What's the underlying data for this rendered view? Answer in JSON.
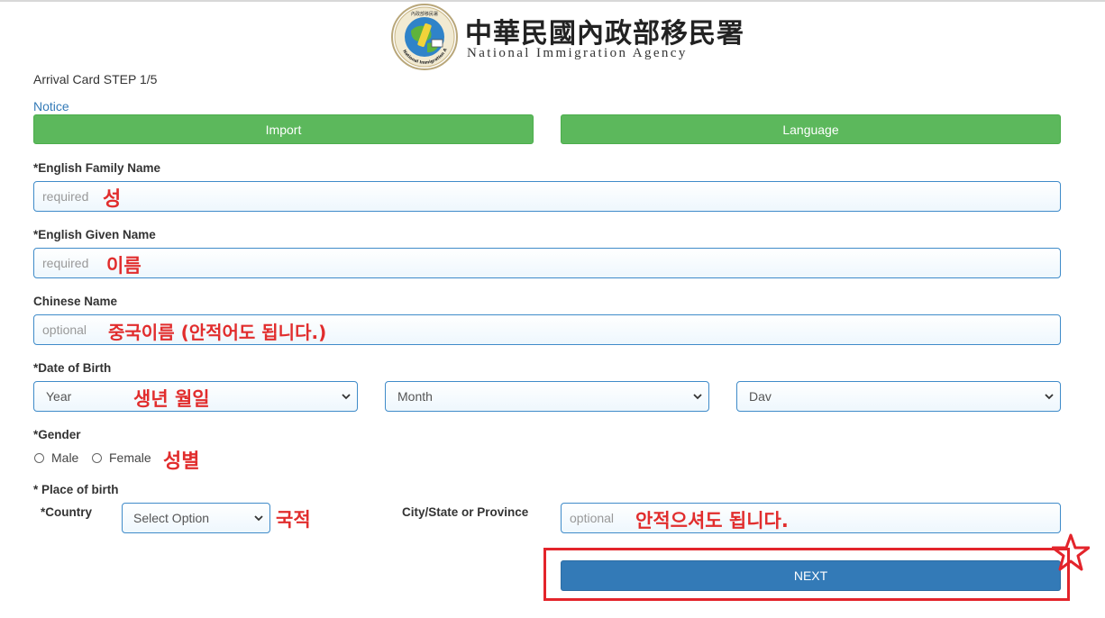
{
  "header": {
    "agency_cn": "中華民國內政部移民署",
    "agency_en": "National Immigration Agency",
    "emblem_label": "National Immigration Agency"
  },
  "form": {
    "step": "Arrival Card STEP 1/5",
    "notice": "Notice",
    "import_label": "Import",
    "language_label": "Language",
    "family_name": {
      "label": "*English Family Name",
      "placeholder": "required",
      "value": ""
    },
    "given_name": {
      "label": "*English Given Name",
      "placeholder": "required",
      "value": ""
    },
    "chinese_name": {
      "label": "Chinese Name",
      "placeholder": "optional",
      "value": ""
    },
    "dob": {
      "label": "*Date of Birth",
      "year": "Year",
      "month": "Month",
      "day": "Dav"
    },
    "gender": {
      "label": "*Gender",
      "male": "Male",
      "female": "Female"
    },
    "place_of_birth": {
      "label": "* Place of birth"
    },
    "country": {
      "label": "*Country",
      "selected": "Select Option"
    },
    "city": {
      "label": "City/State or Province",
      "placeholder": "optional",
      "value": ""
    },
    "next_label": "NEXT"
  },
  "annotations": {
    "family_name": "성",
    "given_name": "이름",
    "chinese_name": "중국이름 (안적어도 됩니다.)",
    "dob": "생년 월일",
    "gender": "성별",
    "country": "국적",
    "city": "안적으셔도 됩니다."
  },
  "colors": {
    "button_green": "#5cb85c",
    "button_blue": "#337ab7",
    "input_border": "#3f8bc9",
    "annotation_red": "#e12d2d",
    "highlight_frame": "#e3242b"
  },
  "icons": {
    "emblem": "agency-emblem-globe",
    "select_arrow": "chevron-down-icon",
    "highlight": "star-icon"
  }
}
